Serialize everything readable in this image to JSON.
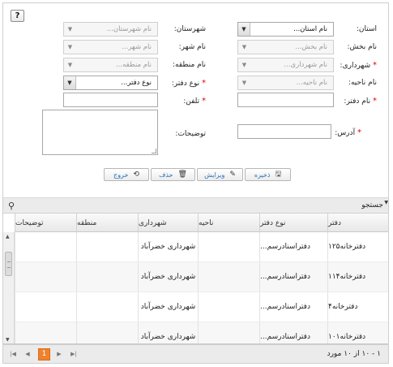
{
  "help": {
    "label": "?"
  },
  "form": {
    "province": {
      "label": "استان:",
      "placeholder": "نام استان..."
    },
    "county": {
      "label": "شهرستان:",
      "placeholder": "نام شهرستان..."
    },
    "district": {
      "label": "نام بخش:",
      "placeholder": "نام بخش..."
    },
    "city": {
      "label": "نام شهر:",
      "placeholder": "نام شهر..."
    },
    "municipality": {
      "label": "شهرداری:",
      "placeholder": "نام شهرداری...",
      "required": "*"
    },
    "region": {
      "label": "نام منطقه:",
      "placeholder": "نام منطقه..."
    },
    "zone": {
      "label": "نام ناحیه:",
      "placeholder": "نام ناحیه..."
    },
    "office_type": {
      "label": "نوع دفتر:",
      "placeholder": "نوع دفتر...",
      "required": "*"
    },
    "office_name": {
      "label": "نام دفتر:",
      "required": "*"
    },
    "phone": {
      "label": "تلفن:",
      "required": "*"
    },
    "address": {
      "label": "آدرس:",
      "required": "*"
    },
    "description": {
      "label": "توضیحات:"
    }
  },
  "actions": {
    "save": "ذخیره",
    "edit": "ویرایش",
    "delete": "حذف",
    "exit": "خروج"
  },
  "search": {
    "title": "جستجو"
  },
  "grid": {
    "columns": [
      "دفتر",
      "نوع دفتر",
      "ناحیه",
      "شهرداری",
      "منطقه",
      "توضیحات"
    ],
    "rows": [
      {
        "office": "دفترخانه۱۲۵",
        "type": "دفتراسنادرسم...",
        "zone": "",
        "municipality": "شهرداری خضرآباد",
        "region": "",
        "desc": ""
      },
      {
        "office": "دفترخانه۱۱۴",
        "type": "دفتراسنادرسم...",
        "zone": "",
        "municipality": "شهرداری خضرآباد",
        "region": "",
        "desc": ""
      },
      {
        "office": "دفترخانه۴",
        "type": "دفتراسنادرسم...",
        "zone": "",
        "municipality": "شهرداری خضرآباد",
        "region": "",
        "desc": ""
      },
      {
        "office": "دفترخانه۱۰۱",
        "type": "دفتراسنادرسم...",
        "zone": "",
        "municipality": "شهرداری خضرآباد",
        "region": "",
        "desc": ""
      }
    ]
  },
  "pager": {
    "info": "۱ - ۱۰ از ۱۰ مورد",
    "current_page": "1"
  }
}
